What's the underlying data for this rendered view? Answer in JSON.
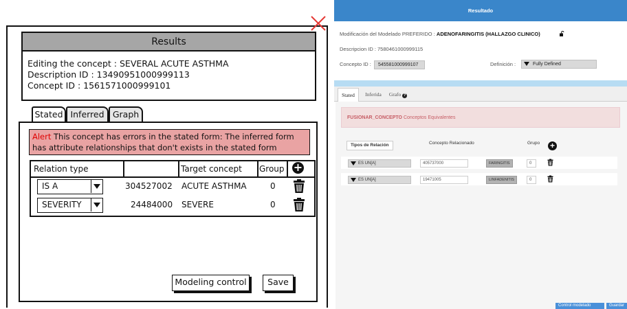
{
  "mockup": {
    "results_title": "Results",
    "concept_line": "Editing the concept : SEVERAL ACUTE ASTHMA",
    "description_line": "Description ID : 13490951000999113",
    "concept_id_line": "Concept ID : 1561571000999101",
    "tabs": [
      {
        "label": "Stated"
      },
      {
        "label": "Inferred"
      },
      {
        "label": "Graph"
      }
    ],
    "alert_word": "Alert",
    "alert_text": " This concept has errors in the stated form: The inferred form has attribute relationships that don't exists in the stated form",
    "table": {
      "headers": {
        "relation_type": "Relation type",
        "target_concept": "Target concept",
        "group": "Group"
      },
      "rows": [
        {
          "relation": "IS A",
          "code": "304527002",
          "target": "ACUTE ASTHMA",
          "group": "0"
        },
        {
          "relation": "SEVERITY",
          "code": "24484000",
          "target": "SEVERE",
          "group": "0"
        }
      ]
    },
    "modeling_control_label": "Modeling control",
    "save_label": "Save"
  },
  "app": {
    "header_title": "Resultado",
    "modification_prefix": "Modificación del Modelado PREFERIDO : ",
    "modification_name": "ADENOFARINGITIS (HALLAZGO CLINICO)",
    "description_line": "Descripcion ID : 7580461000999115",
    "concept_label": "Concepto ID :",
    "concept_id": "545581000999107",
    "definition_label": "Definición :",
    "definition_value": "Fully Defined",
    "tabs": [
      {
        "label": "Stated"
      },
      {
        "label": "Inferida"
      },
      {
        "label": "Grafo"
      }
    ],
    "alert_bold": "FUSIONAR_CONCEPTO",
    "alert_text": " Conceptos Equivalentes",
    "col_relation": "Tipos de Relación",
    "col_related": "Concepto Relacionado",
    "col_group": "Grupo",
    "rows": [
      {
        "relation": "ES UN[A]",
        "code": "405737000",
        "tag": "FARINGITIS",
        "group": "0"
      },
      {
        "relation": "ES UN[A]",
        "code": "19471005",
        "tag": "LINFADENITIS",
        "group": "0"
      }
    ],
    "bottom_buttons": [
      {
        "label": "Control modelado"
      },
      {
        "label": "Guardar"
      }
    ]
  }
}
